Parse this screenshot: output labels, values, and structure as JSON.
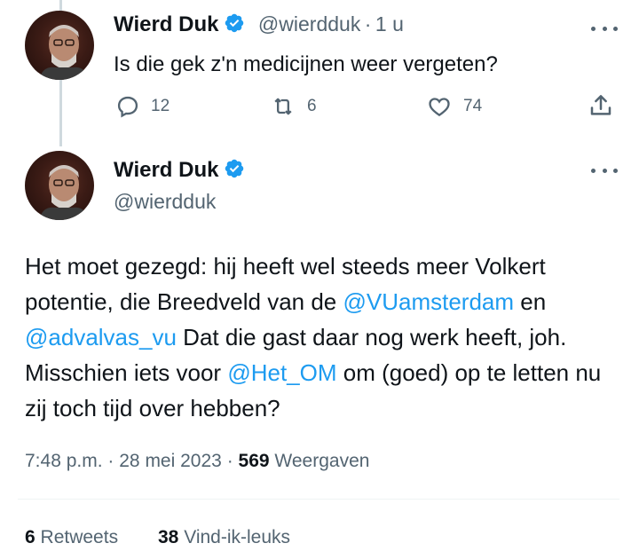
{
  "reply": {
    "author_name": "Wierd Duk",
    "handle": "@wierdduk",
    "separator": "·",
    "time_ago": "1 u",
    "text": "Is die gek z'n medicijnen weer vergeten?",
    "replies": "12",
    "retweets": "6",
    "likes": "74"
  },
  "main": {
    "author_name": "Wierd Duk",
    "handle": "@wierdduk",
    "text": {
      "p1": "Het moet gezegd: hij heeft wel steeds meer Volkert potentie, die Breedveld van de ",
      "mention1": "@VUamsterdam",
      "p2": " en ",
      "mention2": "@advalvas_vu",
      "p3": " Dat die gast daar nog werk heeft, joh. Misschien iets voor ",
      "mention3": "@Het_OM",
      "p4": " om (goed) op te letten nu zij toch tijd over hebben?"
    },
    "timestamp": "7:48 p.m.",
    "date": "28 mei 2023",
    "dot": "·",
    "views_count": "569",
    "views_label": "Weergaven",
    "retweets_count": "6",
    "retweets_label": "Retweets",
    "likes_count": "38",
    "likes_label": "Vind-ik-leuks"
  },
  "colors": {
    "accent": "#1d9bf0",
    "secondary_text": "#536471",
    "primary_text": "#0f1419"
  }
}
